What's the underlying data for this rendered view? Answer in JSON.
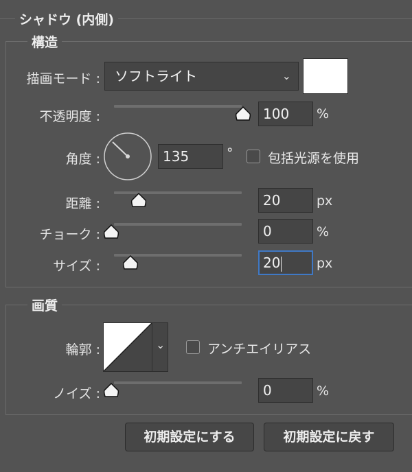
{
  "panel": {
    "title": "シャドウ (内側)"
  },
  "structure": {
    "title": "構造",
    "blend_mode": {
      "label": "描画モード :",
      "value": "ソフトライト",
      "color": "#ffffff"
    },
    "opacity": {
      "label": "不透明度 :",
      "value": "100",
      "unit": "%",
      "slider_fraction": 1.0
    },
    "angle": {
      "label": "角度 :",
      "value": "135",
      "unit": "°",
      "global_light_label": "包括光源を使用",
      "global_light_checked": false
    },
    "distance": {
      "label": "距離 :",
      "value": "20",
      "unit": "px",
      "slider_fraction": 0.2
    },
    "choke": {
      "label": "チョーク :",
      "value": "0",
      "unit": "%",
      "slider_fraction": 0.0
    },
    "size": {
      "label": "サイズ :",
      "value": "20",
      "unit": "px",
      "slider_fraction": 0.13
    }
  },
  "quality": {
    "title": "画質",
    "contour": {
      "label": "輪郭 :",
      "anti_alias_label": "アンチエイリアス",
      "anti_alias_checked": false
    },
    "noise": {
      "label": "ノイズ :",
      "value": "0",
      "unit": "%",
      "slider_fraction": 0.0
    }
  },
  "buttons": {
    "make_default": "初期設定にする",
    "reset_default": "初期設定に戻す"
  },
  "colors": {
    "background": "#535353",
    "focus": "#3f79c6"
  }
}
